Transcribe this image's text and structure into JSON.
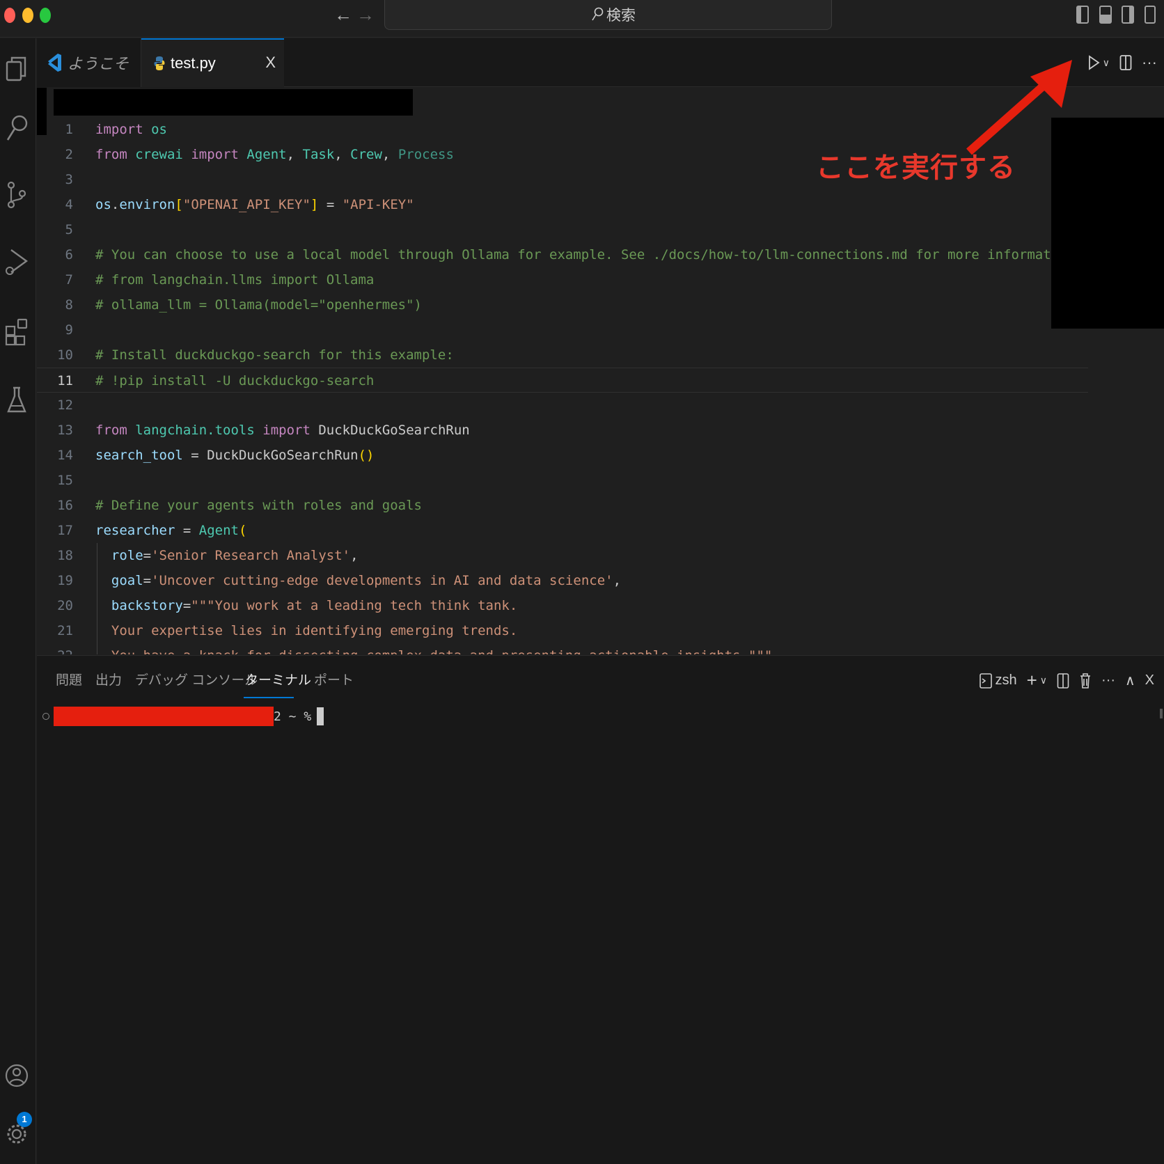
{
  "titlebar": {
    "search_label": "検索"
  },
  "tabs": [
    {
      "label": "ようこそ",
      "icon": "vscode-logo-icon"
    },
    {
      "label": "test.py",
      "icon": "python-icon",
      "close": "X"
    }
  ],
  "editor": {
    "current_line": 11,
    "line_numbers": [
      "1",
      "2",
      "3",
      "4",
      "5",
      "6",
      "7",
      "8",
      "9",
      "10",
      "11",
      "12",
      "13",
      "14",
      "15",
      "16",
      "17",
      "18",
      "19",
      "20",
      "21",
      "22"
    ]
  },
  "code": {
    "l1": {
      "kw": "import",
      "mod": "os"
    },
    "l2": {
      "kw1": "from",
      "mod": "crewai",
      "kw2": "import",
      "c1": "Agent",
      "c2": "Task",
      "c3": "Crew",
      "c4": "Process"
    },
    "l4": {
      "obj": "os",
      "attr": "environ",
      "key": "\"OPENAI_API_KEY\"",
      "eq": "=",
      "val": "\"API-KEY\""
    },
    "l6": "# You can choose to use a local model through Ollama for example. See ./docs/how-to/llm-connections.md for more information.",
    "l7": "# from langchain.llms import Ollama",
    "l8": "# ollama_llm = Ollama(model=\"openhermes\")",
    "l10": "# Install duckduckgo-search for this example:",
    "l11": "# !pip install -U duckduckgo-search",
    "l13": {
      "kw1": "from",
      "mod": "langchain.tools",
      "kw2": "import",
      "cls": "DuckDuckGoSearchRun"
    },
    "l14": {
      "var": "search_tool",
      "eq": "=",
      "fn": "DuckDuckGoSearchRun"
    },
    "l16": "# Define your agents with roles and goals",
    "l17": {
      "var": "researcher",
      "eq": "=",
      "cls": "Agent"
    },
    "l18": {
      "arg": "role",
      "val": "'Senior Research Analyst'"
    },
    "l19": {
      "arg": "goal",
      "val": "'Uncover cutting-edge developments in AI and data science'"
    },
    "l20": {
      "arg": "backstory",
      "val": "\"\"\"You work at a leading tech think tank."
    },
    "l21": "Your expertise lies in identifying emerging trends.",
    "l22": "You have a knack for dissecting complex data and presenting actionable insights.\"\"\""
  },
  "annotation": {
    "text": "ここを実行する",
    "color": "#e8382c"
  },
  "panel": {
    "tabs": [
      "問題",
      "出力",
      "デバッグ コンソール",
      "ターミナル",
      "ポート"
    ],
    "active_tab": "ターミナル",
    "shell": "zsh",
    "prompt_suffix": "2 ~ %"
  },
  "activity": {
    "accounts_badge": "1"
  },
  "colors": {
    "accent": "#0078d4",
    "redaction": "#e51f0e"
  }
}
